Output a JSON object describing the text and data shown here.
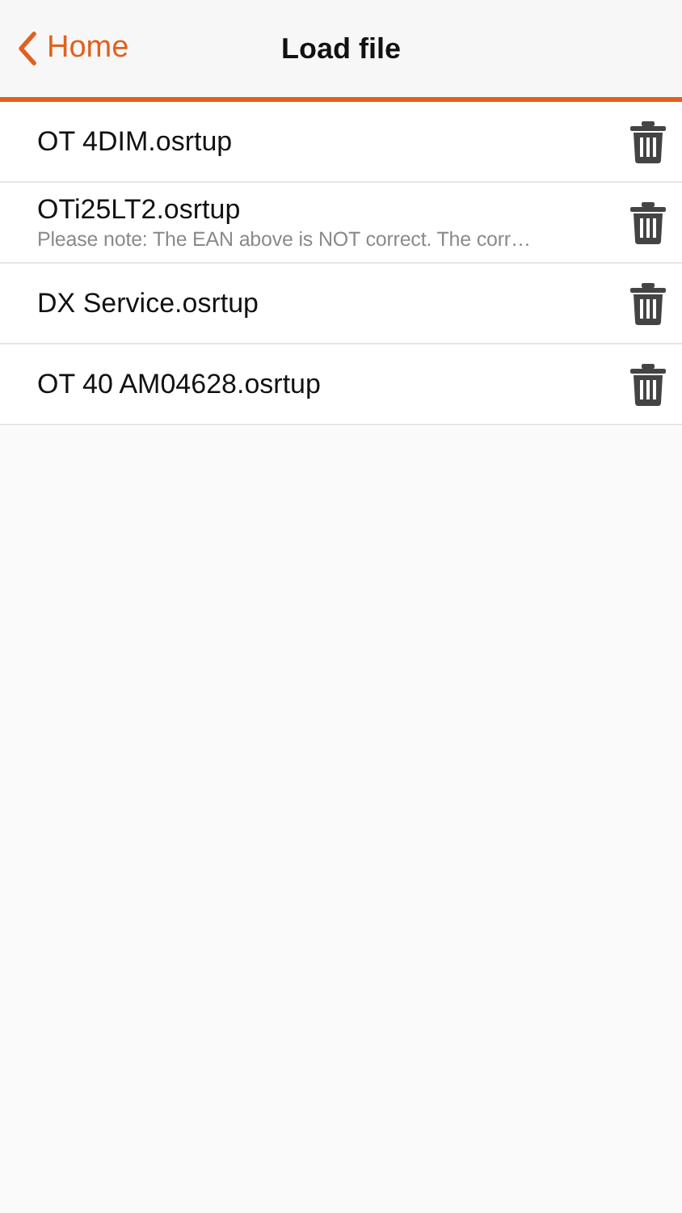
{
  "nav": {
    "back": "Home",
    "title": "Load file"
  },
  "files": [
    {
      "name": "OT 4DIM.osrtup"
    },
    {
      "name": "OTi25LT2.osrtup",
      "note": "Please note: The EAN above is NOT correct. The corr…"
    },
    {
      "name": "DX Service.osrtup"
    },
    {
      "name": "OT 40 AM04628.osrtup"
    }
  ]
}
